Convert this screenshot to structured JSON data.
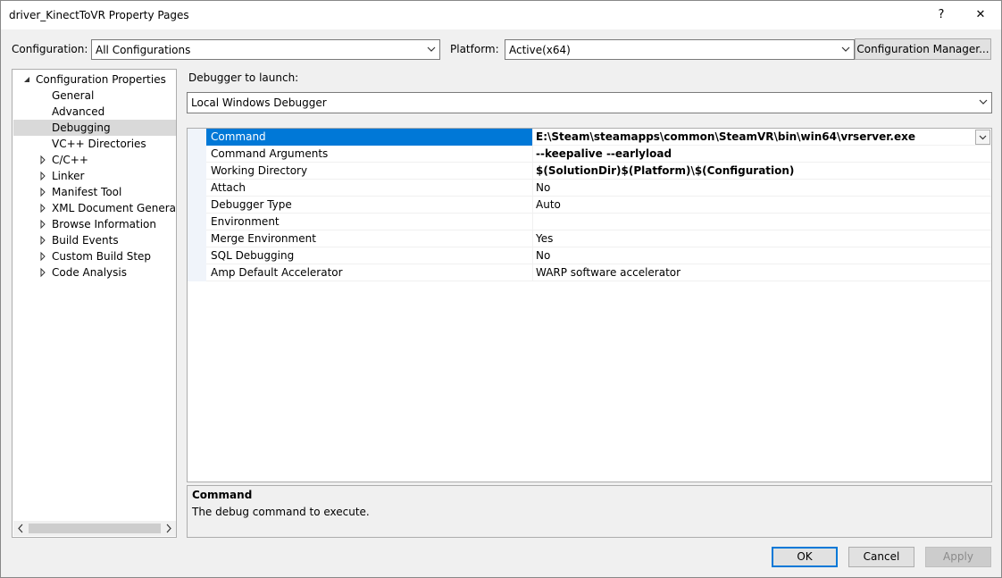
{
  "window": {
    "title": "driver_KinectToVR Property Pages",
    "help_label": "?",
    "close_label": "✕"
  },
  "config_bar": {
    "configuration_label": "Configuration:",
    "configuration_value": "All Configurations",
    "platform_label": "Platform:",
    "platform_value": "Active(x64)",
    "config_manager_label": "Configuration Manager..."
  },
  "tree": {
    "items": [
      {
        "label": "Configuration Properties",
        "expander": "expanded"
      },
      {
        "label": "General",
        "expander": "none"
      },
      {
        "label": "Advanced",
        "expander": "none"
      },
      {
        "label": "Debugging",
        "expander": "none",
        "selected": true
      },
      {
        "label": "VC++ Directories",
        "expander": "none"
      },
      {
        "label": "C/C++",
        "expander": "collapsed"
      },
      {
        "label": "Linker",
        "expander": "collapsed"
      },
      {
        "label": "Manifest Tool",
        "expander": "collapsed"
      },
      {
        "label": "XML Document Generator",
        "expander": "collapsed"
      },
      {
        "label": "Browse Information",
        "expander": "collapsed"
      },
      {
        "label": "Build Events",
        "expander": "collapsed"
      },
      {
        "label": "Custom Build Step",
        "expander": "collapsed"
      },
      {
        "label": "Code Analysis",
        "expander": "collapsed"
      }
    ]
  },
  "debugger": {
    "label": "Debugger to launch:",
    "value": "Local Windows Debugger"
  },
  "properties": [
    {
      "name": "Command",
      "value": "E:\\Steam\\steamapps\\common\\SteamVR\\bin\\win64\\vrserver.exe",
      "bold": true,
      "selected": true
    },
    {
      "name": "Command Arguments",
      "value": "--keepalive --earlyload",
      "bold": true
    },
    {
      "name": "Working Directory",
      "value": "$(SolutionDir)$(Platform)\\$(Configuration)",
      "bold": true
    },
    {
      "name": "Attach",
      "value": "No"
    },
    {
      "name": "Debugger Type",
      "value": "Auto"
    },
    {
      "name": "Environment",
      "value": ""
    },
    {
      "name": "Merge Environment",
      "value": "Yes"
    },
    {
      "name": "SQL Debugging",
      "value": "No"
    },
    {
      "name": "Amp Default Accelerator",
      "value": "WARP software accelerator"
    }
  ],
  "description": {
    "title": "Command",
    "text": "The debug command to execute."
  },
  "buttons": {
    "ok": "OK",
    "cancel": "Cancel",
    "apply": "Apply"
  },
  "colors": {
    "accent": "#0078d7",
    "selection_gray": "#d9d9d9"
  }
}
